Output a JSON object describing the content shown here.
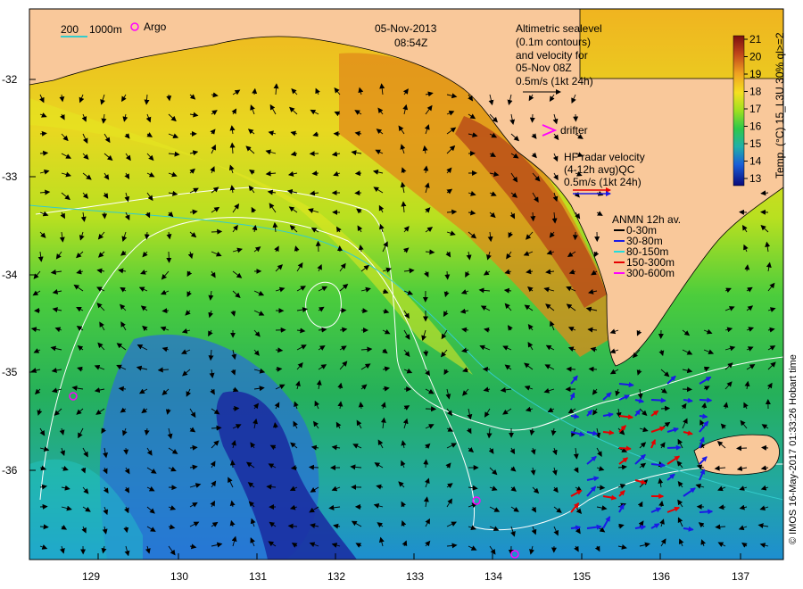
{
  "title": {
    "date": "05-Nov-2013",
    "time": "08:54Z"
  },
  "depth_key": {
    "a": "200",
    "b": "1000m"
  },
  "argo_label": "Argo",
  "altimetry_note": {
    "line1": "Altimetric sealevel",
    "line2": "(0.1m contours)",
    "line3": "and velocity for",
    "line4": "05-Nov 08Z",
    "line5": "0.5m/s (1kt 24h)"
  },
  "drifter_label": "drifter",
  "hf_radar_note": {
    "line1": "HF radar velocity",
    "line2": "(4-12h avg)QC",
    "line3": "0.5m/s (1kt 24h)"
  },
  "anmn_legend": {
    "title": "ANMN 12h av.",
    "items": [
      {
        "label": "0-30m",
        "color": "#000000"
      },
      {
        "label": "30-80m",
        "color": "#1a1ae6"
      },
      {
        "label": "80-150m",
        "color": "#22dddd"
      },
      {
        "label": "150-300m",
        "color": "#e60000"
      },
      {
        "label": "300-600m",
        "color": "#ff00ff"
      }
    ]
  },
  "colorbar": {
    "ticks": [
      "21",
      "20",
      "19",
      "18",
      "17",
      "16",
      "15",
      "14",
      "13"
    ],
    "label": "Temp. (°C) 15_L3U 30% ql>=2",
    "min": 12.5,
    "max": 21.5
  },
  "credit": "© IMOS 16-May-2017 01:33:26 Hobart time",
  "axes": {
    "lat_ticks": [
      "-32",
      "-33",
      "-34",
      "-35",
      "-36"
    ],
    "lon_ticks": [
      "129",
      "130",
      "131",
      "132",
      "133",
      "134",
      "135",
      "136",
      "137"
    ]
  },
  "colors": {
    "land": "#f9c89a",
    "ocean_warm": "#d4741a",
    "ocean_cool": "#1b3fb0"
  }
}
